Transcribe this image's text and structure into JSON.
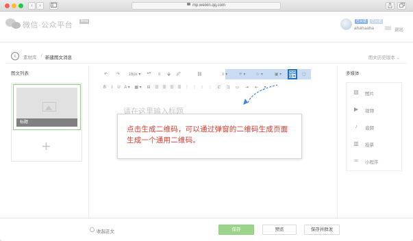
{
  "browser": {
    "url": "mp.weixin.qq.com",
    "nav_back": "‹",
    "nav_forward": "›",
    "sidebar_icon": "sidebar-icon",
    "share_icon": "share-icon",
    "tabs_icon": "tabs-icon"
  },
  "header": {
    "brand": "微信·公众平台",
    "brand_tag": "Beta",
    "verified_badge": "已认证",
    "verified_badge2": "已认证",
    "username": "ahahaaha",
    "logout": "退出"
  },
  "breadcrumb": {
    "back_icon": "back-arrow-icon",
    "parent": "素材库",
    "separator": "/",
    "current": "新建图文消息",
    "history": "图文历史版本 ⌄"
  },
  "left_panel": {
    "title": "图文列表",
    "card_title": "标题",
    "add_label": "+"
  },
  "toolbar": {
    "row1": [
      "↶",
      "↷",
      "16px ▾",
      "❝❞",
      "≡",
      "⬙",
      "🖉",
      "⛓",
      "≡ ▾",
      "⚟ ▾",
      "☺ ▾",
      "▣ ▾",
      "⊞",
      "▢"
    ],
    "row2": [
      "B",
      "I",
      "U",
      "A ▾",
      "▦ ▾",
      "⊟",
      "☰",
      "☰",
      "☰",
      "☰",
      "⋮",
      "⋮",
      "⁝",
      "⫶",
      "⊏",
      "⊐",
      "▭",
      "⇥",
      "⇤",
      "▾"
    ]
  },
  "editor": {
    "title_placeholder": "请在这里输入标题"
  },
  "tooltip": {
    "text": "点击生成二维码，可以通过弹窗的二维码生成页面生成一个通用二维码。"
  },
  "media": {
    "title": "多媒体",
    "items": [
      {
        "icon": "image-icon",
        "label": "图片"
      },
      {
        "icon": "video-icon",
        "label": "视频"
      },
      {
        "icon": "audio-icon",
        "label": "音频"
      },
      {
        "icon": "vote-icon",
        "label": "投票"
      },
      {
        "icon": "mini-program-icon",
        "label": "小程序"
      }
    ]
  },
  "footer": {
    "collapse_label": "收起正文",
    "save": "保存",
    "preview": "预览",
    "save_send": "保存并群发"
  },
  "colors": {
    "highlight_border": "#1b6fc2",
    "toolbar_band": "#c8ddf4",
    "save_button": "#9bd48a",
    "tooltip_text": "#e23a2e"
  }
}
